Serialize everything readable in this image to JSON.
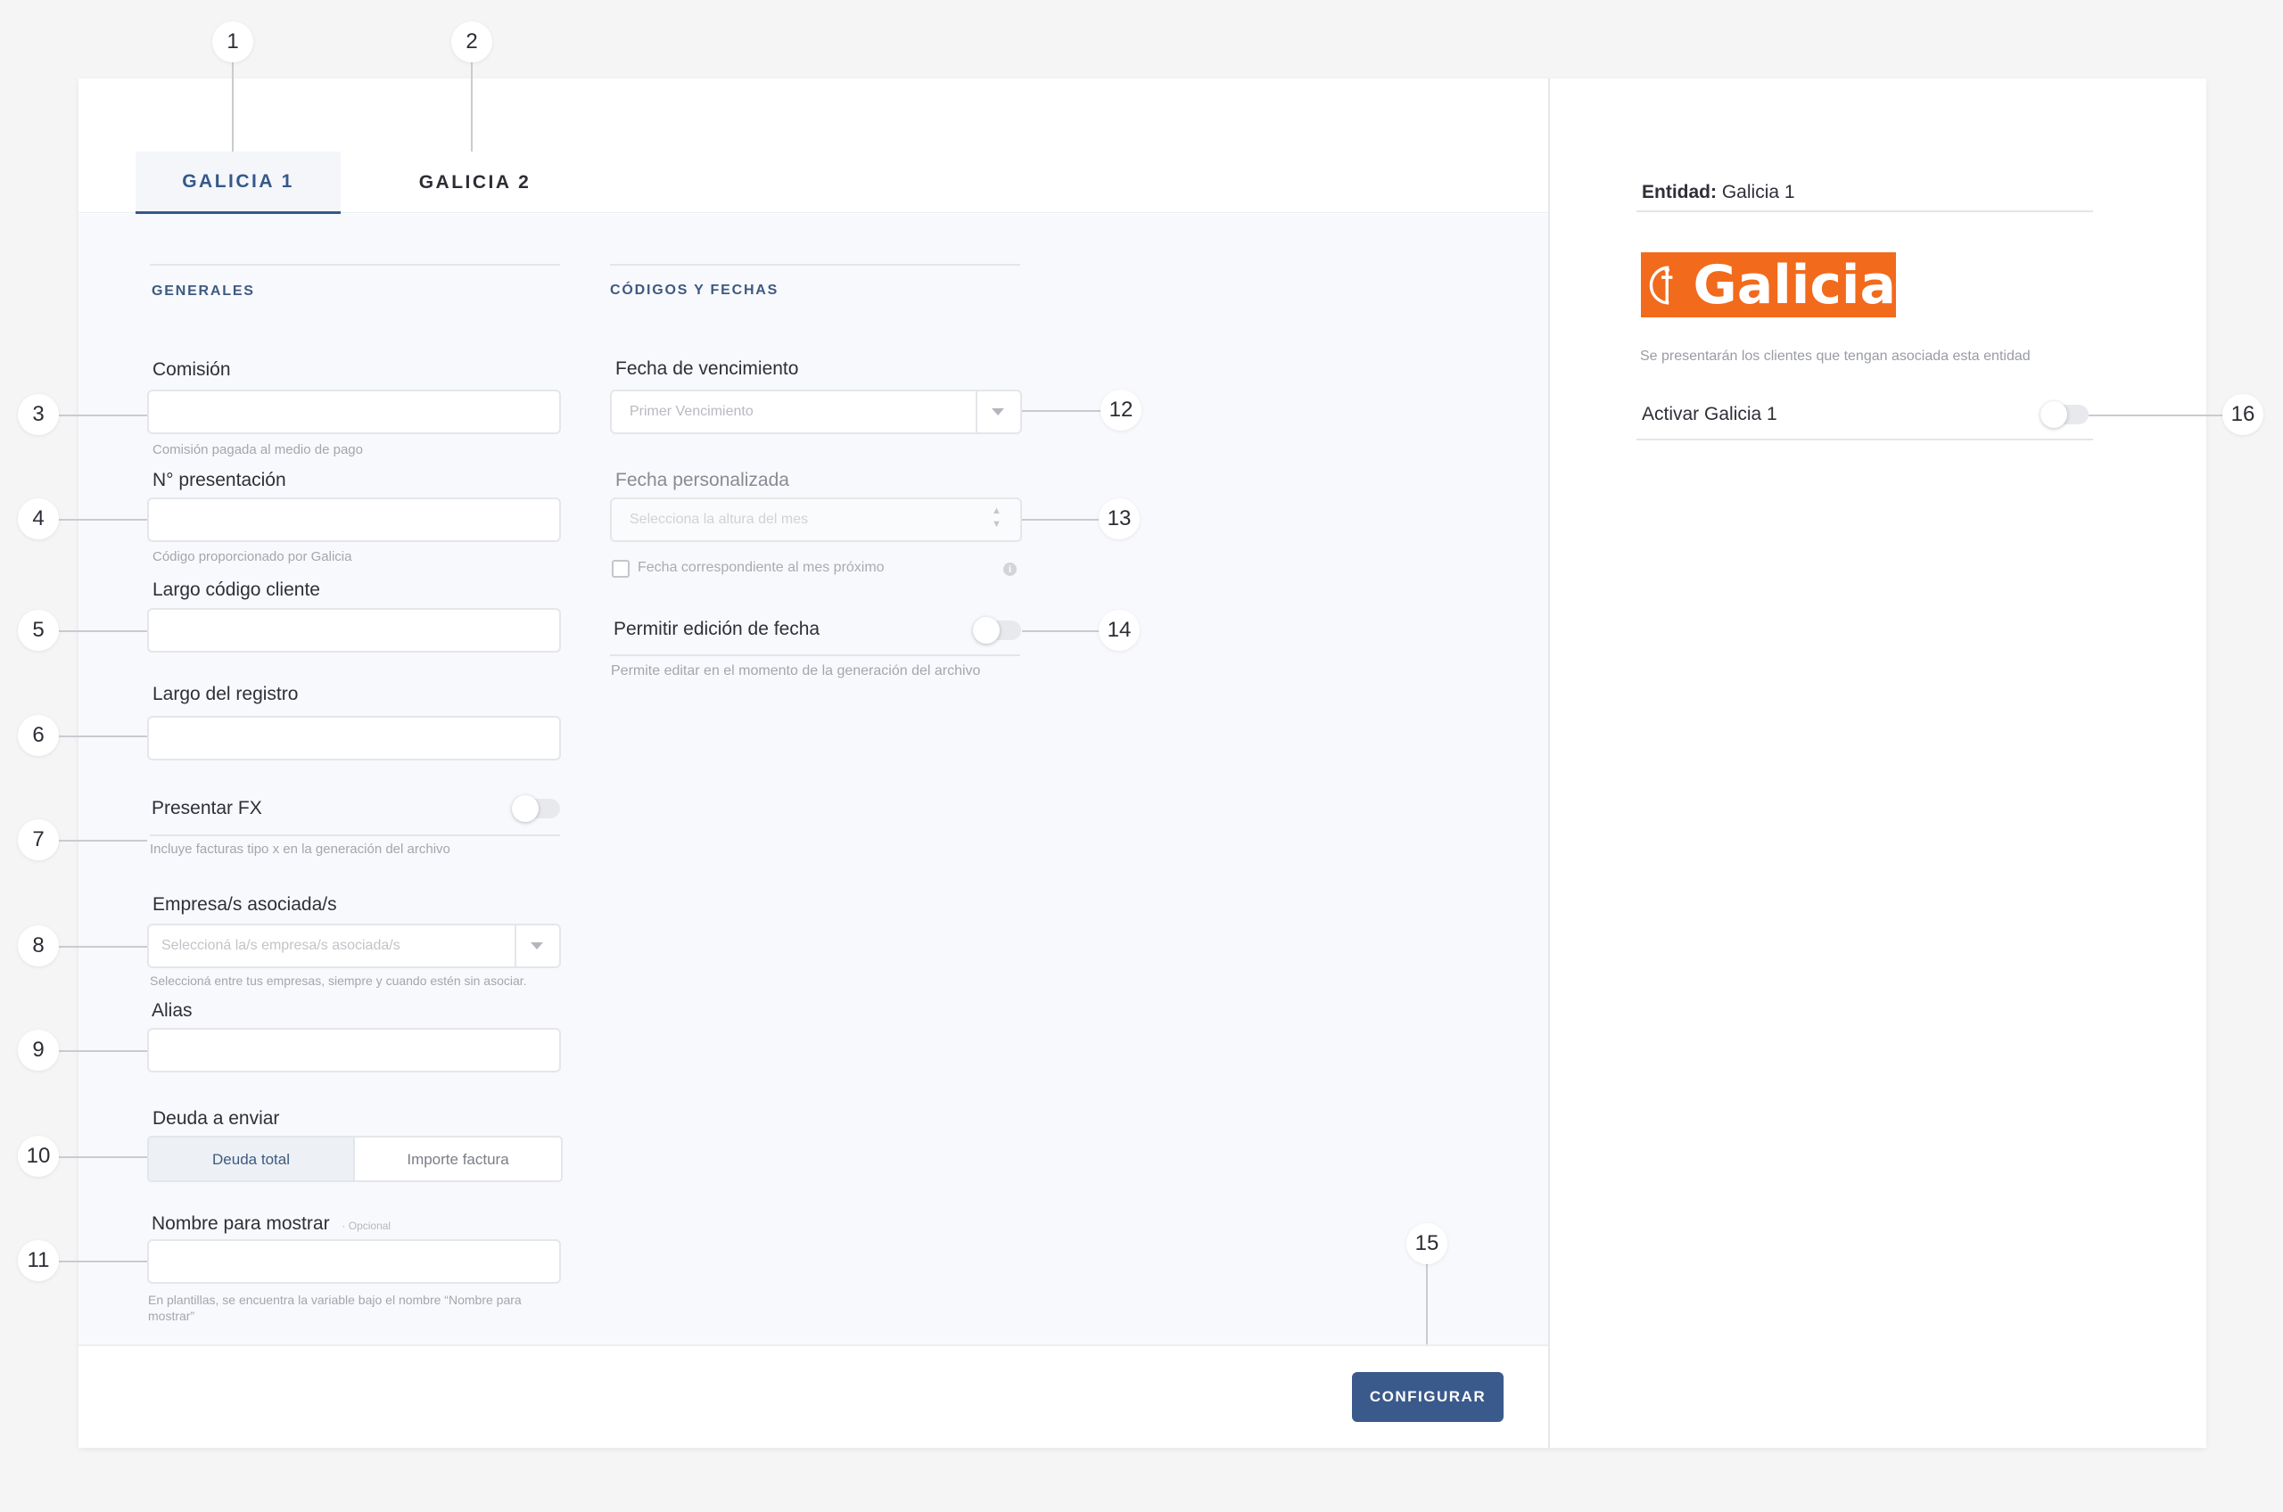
{
  "tabs": [
    {
      "label": "GALICIA 1",
      "active": true
    },
    {
      "label": "GALICIA 2",
      "active": false
    }
  ],
  "sections": {
    "general": "GENERALES",
    "codes": "CÓDIGOS Y FECHAS"
  },
  "fields": {
    "commission": {
      "label": "Comisión",
      "value": "",
      "helper": "Comisión pagada al medio de pago"
    },
    "presentation_number": {
      "label": "N° presentación",
      "value": "",
      "helper": "Código proporcionado por Galicia"
    },
    "client_code_length": {
      "label": "Largo código cliente",
      "value": ""
    },
    "record_length": {
      "label": "Largo del registro",
      "value": ""
    },
    "present_fx": {
      "label": "Presentar FX",
      "enabled": false,
      "helper": "Incluye facturas tipo x en la generación del archivo"
    },
    "associated_companies": {
      "label": "Empresa/s asociada/s",
      "placeholder": "Seleccioná la/s empresa/s asociada/s",
      "helper": "Seleccioná entre tus empresas, siempre y cuando estén sin asociar."
    },
    "alias": {
      "label": "Alias",
      "value": ""
    },
    "debt": {
      "label": "Deuda a enviar",
      "options": [
        "Deuda total",
        "Importe factura"
      ],
      "selected": "Deuda total"
    },
    "display_name": {
      "label": "Nombre para mostrar",
      "optional": "· Opcional",
      "value": "",
      "helper": "En plantillas, se encuentra la variable bajo el nombre “Nombre para mostrar”"
    },
    "due_date": {
      "label": "Fecha de vencimiento",
      "selected": "Primer Vencimiento"
    },
    "custom_date": {
      "label": "Fecha personalizada",
      "placeholder": "Selecciona la altura del mes",
      "checkbox_label": "Fecha correspondiente al mes próximo",
      "checked": false
    },
    "allow_date_edit": {
      "label": "Permitir edición de fecha",
      "enabled": false,
      "helper": "Permite editar en el momento de la generación del archivo"
    }
  },
  "footer": {
    "configure_label": "CONFIGURAR"
  },
  "entity": {
    "label": "Entidad:",
    "value": "Galicia 1",
    "logo_text": "Galicia",
    "description": "Se presentarán los clientes que tengan asociada esta entidad",
    "activate_label": "Activar Galicia 1",
    "activate_enabled": false
  },
  "callouts": [
    "1",
    "2",
    "3",
    "4",
    "5",
    "6",
    "7",
    "8",
    "9",
    "10",
    "11",
    "12",
    "13",
    "14",
    "15",
    "16"
  ],
  "colors": {
    "accent": "#3a5a8c",
    "brand_orange": "#f26a1b",
    "form_background": "#f8f9fc"
  }
}
